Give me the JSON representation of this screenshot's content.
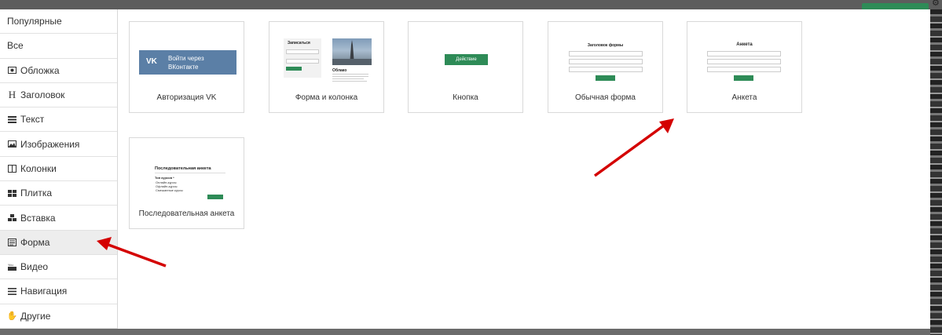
{
  "sidebar": {
    "items": [
      {
        "label": "Популярные",
        "icon": ""
      },
      {
        "label": "Все",
        "icon": ""
      },
      {
        "label": "Обложка",
        "icon": "cover-icon"
      },
      {
        "label": "Заголовок",
        "icon": "heading-icon"
      },
      {
        "label": "Текст",
        "icon": "text-icon"
      },
      {
        "label": "Изображения",
        "icon": "image-icon"
      },
      {
        "label": "Колонки",
        "icon": "columns-icon"
      },
      {
        "label": "Плитка",
        "icon": "tiles-icon"
      },
      {
        "label": "Вставка",
        "icon": "embed-icon"
      },
      {
        "label": "Форма",
        "icon": "form-icon",
        "active": true
      },
      {
        "label": "Видео",
        "icon": "youtube-icon"
      },
      {
        "label": "Навигация",
        "icon": "menu-icon"
      },
      {
        "label": "Другие",
        "icon": "hand-icon"
      }
    ]
  },
  "cards": [
    {
      "caption": "Авторизация VK",
      "button": "Войти через ВКонтакте",
      "logo": "VK"
    },
    {
      "caption": "Форма и колонка",
      "form_title": "Запиcаться",
      "photo_title": "Облако"
    },
    {
      "caption": "Кнопка",
      "button": "Действие"
    },
    {
      "caption": "Обычная форма",
      "title": "Заголовок формы"
    },
    {
      "caption": "Анкета",
      "title": "Анкета"
    },
    {
      "caption": "Последовательная анкета",
      "title": "Последовательная анкета",
      "question": "Тип курсов *",
      "options": [
        "Онлайн-курсы",
        "Офлайн-курсы",
        "Смешанные курсы"
      ]
    }
  ],
  "colors": {
    "accent": "#2e8b57",
    "vk": "#5b7fa6",
    "arrow": "#d40000"
  }
}
